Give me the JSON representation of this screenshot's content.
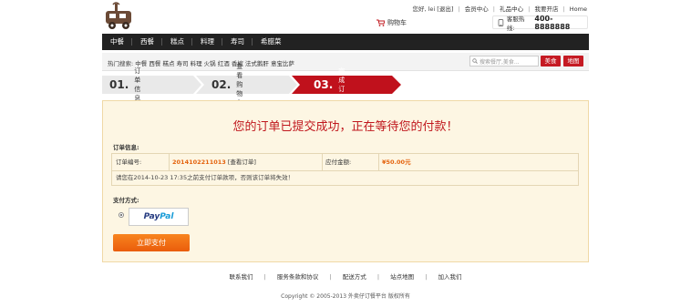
{
  "header": {
    "logo_icon": "food-truck-logo",
    "greeting": "您好, lei",
    "logout": "[退出]",
    "links": [
      "会员中心",
      "礼品中心",
      "我要开店",
      "Home"
    ],
    "cart_label": "购物车",
    "hotline_label": "客服热线:",
    "hotline_number": "400-8888888"
  },
  "nav": {
    "items": [
      "中餐",
      "西餐",
      "糕点",
      "料理",
      "寿司",
      "希腊菜"
    ]
  },
  "search": {
    "hot_label": "热门搜索:",
    "hot_items": [
      "中餐",
      "西餐",
      "糕点",
      "寿司",
      "料理",
      "火锅",
      "红酒",
      "香槟",
      "法式鹅肝",
      "意宝比萨"
    ],
    "placeholder": "搜索餐厅,美食...",
    "btn_food": "美食",
    "btn_map": "地图"
  },
  "steps": [
    {
      "num": "01.",
      "label": "订单信息"
    },
    {
      "num": "02.",
      "label": "查看购物车"
    },
    {
      "num": "03.",
      "label": "完成订单"
    }
  ],
  "accent_color": "#c0171d",
  "main": {
    "headline": "您的订单已提交成功，正在等待您的付款！",
    "order_info_title": "订单信息:",
    "order_no_label": "订单编号:",
    "order_no": "2014102211013",
    "view_order": "[查看订单]",
    "amount_label": "应付金额:",
    "amount": "¥50.00元",
    "note": "请您在2014-10-23 17:35之前支付订单款项，否则该订单将失效！",
    "payment_title": "支付方式:",
    "paypal_pay": "Pay",
    "paypal_pal": "Pal",
    "pay_button": "立即支付"
  },
  "footer": {
    "links": [
      "联系我们",
      "服务条款和协议",
      "配送方式",
      "站点地图",
      "加入我们"
    ],
    "copyright": "Copyright © 2005-2013 外卖仔订餐平台 版权所有"
  }
}
